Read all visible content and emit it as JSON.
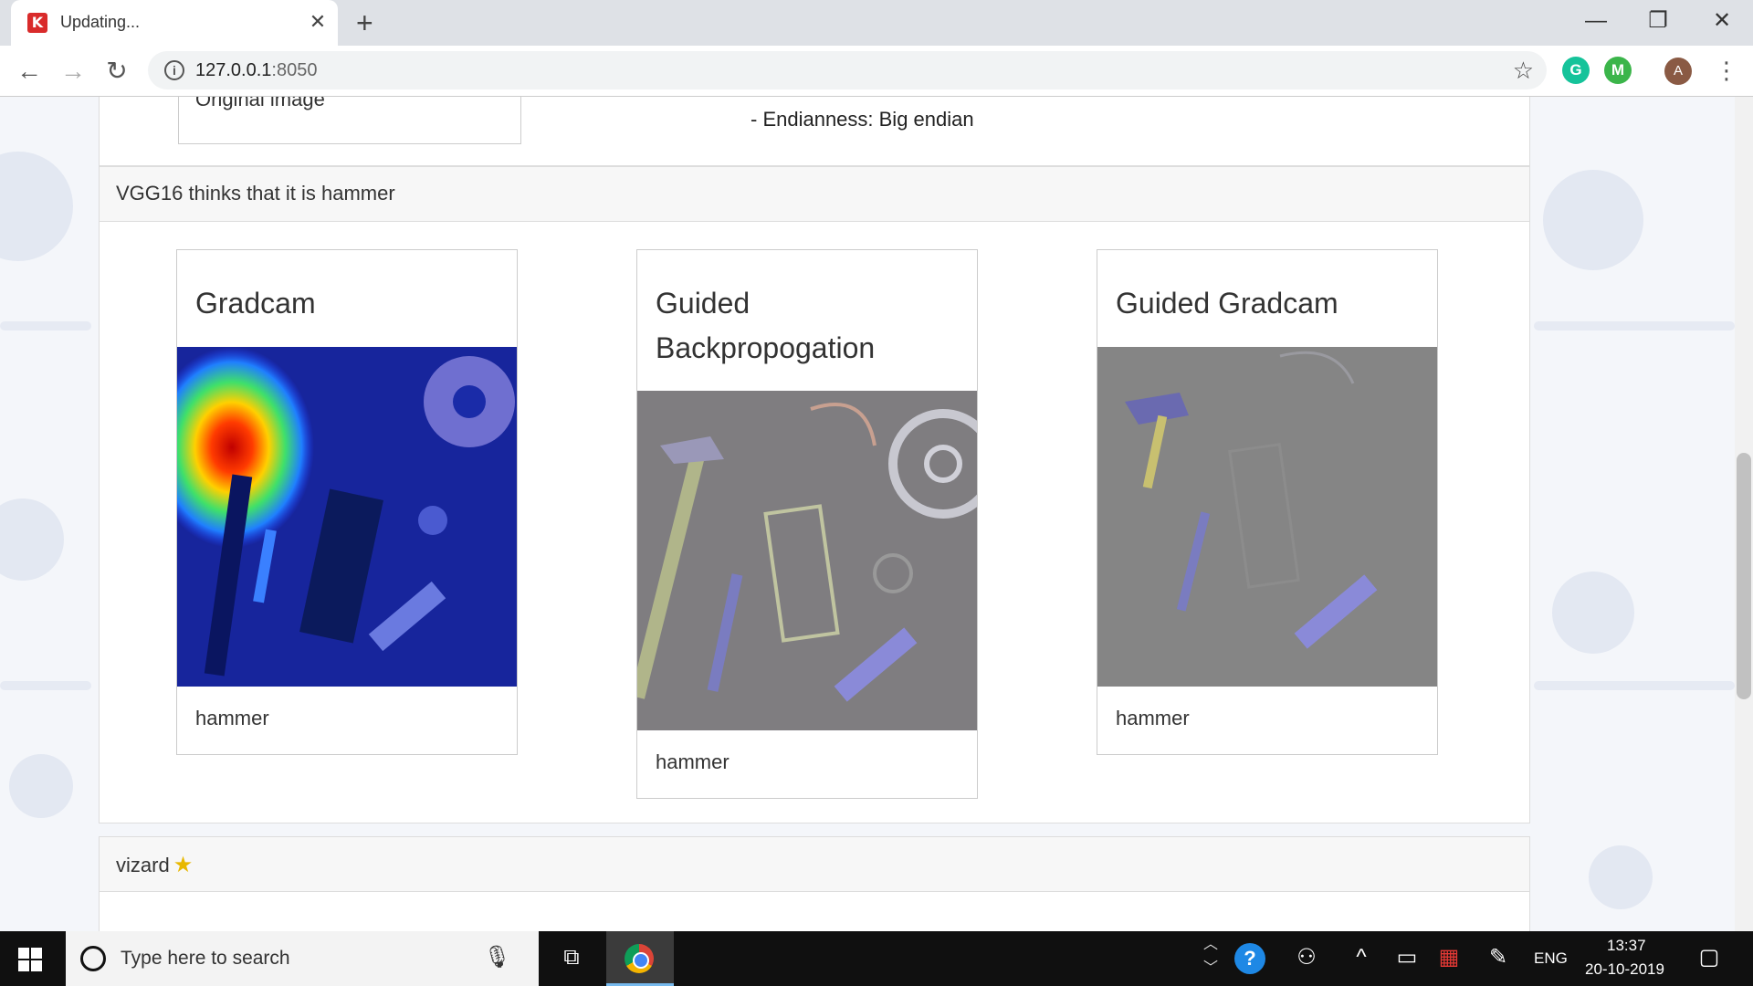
{
  "browser": {
    "tab_title": "Updating...",
    "tab_favicon_letter": "K",
    "url_host": "127.0.0.1",
    "url_port": ":8050",
    "avatar_letter": "A"
  },
  "page": {
    "original_image_label": "Original image",
    "endianness": "- Endianness: Big endian",
    "prediction_header": "VGG16 thinks that it is hammer",
    "panels": [
      {
        "title": "Gradcam",
        "caption": "hammer"
      },
      {
        "title": "Guided Backpropogation",
        "caption": "hammer"
      },
      {
        "title": "Guided Gradcam",
        "caption": "hammer"
      }
    ],
    "vizard_header": "vizard"
  },
  "taskbar": {
    "search_placeholder": "Type here to search",
    "language": "ENG",
    "time": "13:37",
    "date": "20-10-2019"
  },
  "colors": {
    "chrome_bg": "#dee1e6",
    "card_header_bg": "#f7f7f7",
    "taskbar_bg": "#101010"
  },
  "icons": [
    "start-icon",
    "search-icon",
    "mic-icon",
    "task-view-icon",
    "chrome-icon",
    "help-icon",
    "people-icon",
    "battery-icon",
    "notification-icon",
    "star-icon",
    "info-icon"
  ]
}
